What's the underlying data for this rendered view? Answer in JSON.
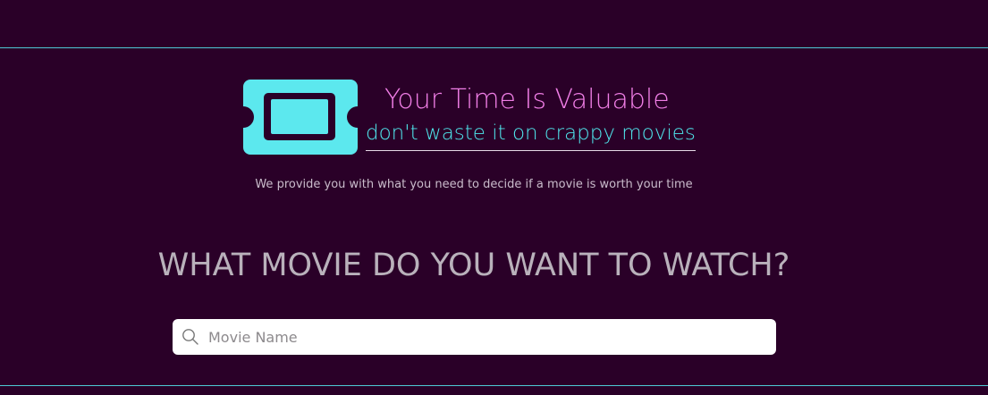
{
  "hero": {
    "tagline_main": "Your Time Is Valuable",
    "tagline_sub": "don't waste it on crappy movies",
    "description": "We provide you with what you need to decide if a movie is worth your time"
  },
  "main": {
    "heading": "WHAT MOVIE DO YOU WANT TO WATCH?"
  },
  "search": {
    "placeholder": "Movie Name",
    "value": "",
    "icon": "search-icon"
  },
  "logo": {
    "icon": "ticket-screen-icon"
  },
  "colors": {
    "background": "#2a0028",
    "accent_cyan": "#5ce8ee",
    "accent_pink": "#f07ee6",
    "divider": "#4ec9d6"
  }
}
